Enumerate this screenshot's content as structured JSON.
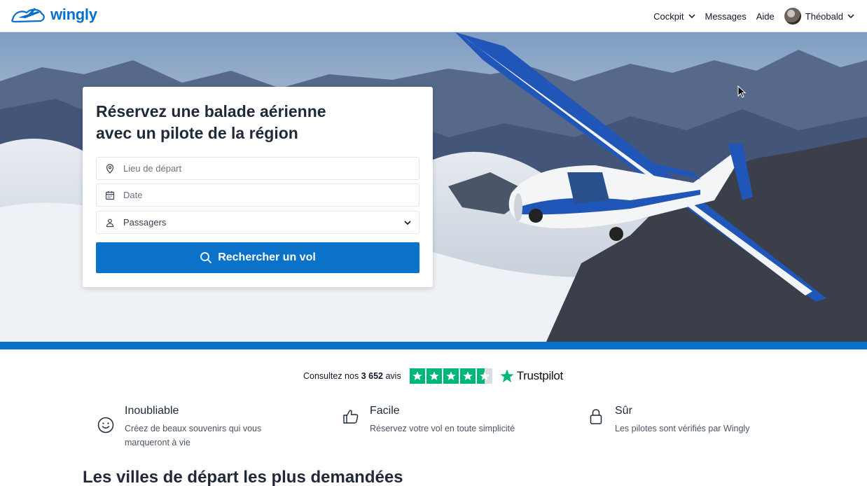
{
  "header": {
    "brand": "wingly",
    "nav": {
      "cockpit": "Cockpit",
      "messages": "Messages",
      "help": "Aide",
      "user": "Théobald"
    }
  },
  "search_card": {
    "title_line1": "Réservez une balade aérienne",
    "title_line2": "avec un pilote de la région",
    "departure_placeholder": "Lieu de départ",
    "date_placeholder": "Date",
    "passengers_label": "Passagers",
    "search_button": "Rechercher un vol"
  },
  "trustpilot": {
    "prefix": "Consultez nos",
    "count": "3 652",
    "suffix": "avis",
    "brand": "Trustpilot",
    "rating_stars": 4.5
  },
  "features": [
    {
      "icon": "smiley-icon",
      "title": "Inoubliable",
      "description": "Créez de beaux souvenirs qui vous marqueront à vie"
    },
    {
      "icon": "thumbs-up-icon",
      "title": "Facile",
      "description": "Réservez votre vol en toute simplicité"
    },
    {
      "icon": "lock-icon",
      "title": "Sûr",
      "description": "Les pilotes sont vérifiés par Wingly"
    }
  ],
  "section": {
    "title": "Les villes de départ les plus demandées"
  },
  "colors": {
    "brand_blue": "#0a6fc9",
    "trustpilot_green": "#00b67a"
  }
}
